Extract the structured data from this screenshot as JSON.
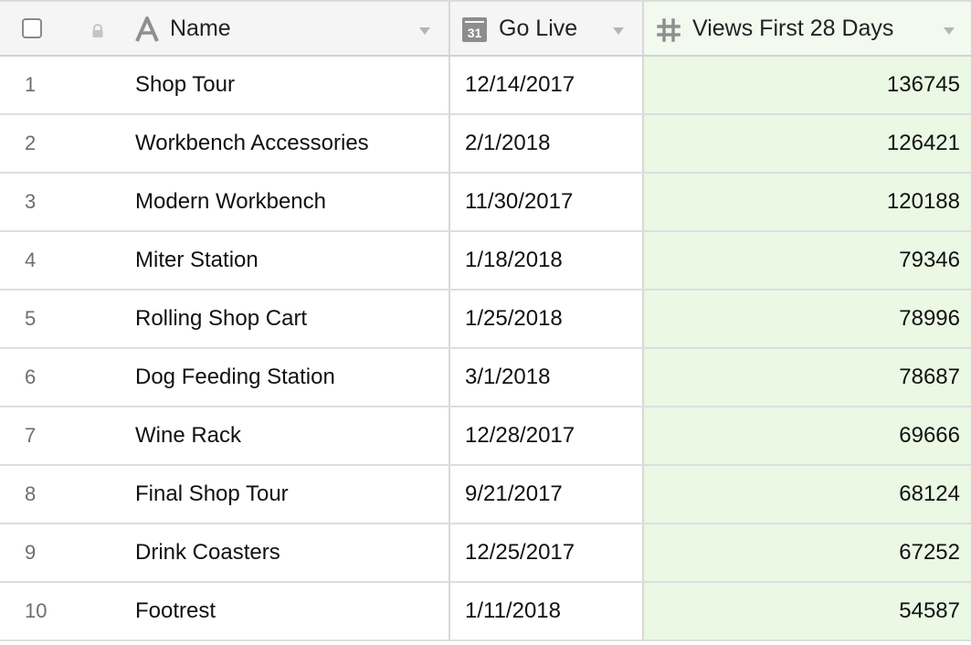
{
  "header": {
    "columns": [
      {
        "label": "Name",
        "type_icon": "text-type-icon"
      },
      {
        "label": "Go Live",
        "type_icon": "calendar-icon",
        "icon_text": "31"
      },
      {
        "label": "Views First 28 Days",
        "type_icon": "hash-icon"
      }
    ]
  },
  "colors": {
    "views_column_bg": "#eaf8e4",
    "header_bg": "#f5f5f5"
  },
  "rows": [
    {
      "num": "1",
      "name": "Shop Tour",
      "go_live": "12/14/2017",
      "views": "136745"
    },
    {
      "num": "2",
      "name": "Workbench Accessories",
      "go_live": "2/1/2018",
      "views": "126421"
    },
    {
      "num": "3",
      "name": "Modern Workbench",
      "go_live": "11/30/2017",
      "views": "120188"
    },
    {
      "num": "4",
      "name": "Miter Station",
      "go_live": "1/18/2018",
      "views": "79346"
    },
    {
      "num": "5",
      "name": "Rolling Shop Cart",
      "go_live": "1/25/2018",
      "views": "78996"
    },
    {
      "num": "6",
      "name": "Dog Feeding Station",
      "go_live": "3/1/2018",
      "views": "78687"
    },
    {
      "num": "7",
      "name": "Wine Rack",
      "go_live": "12/28/2017",
      "views": "69666"
    },
    {
      "num": "8",
      "name": "Final Shop Tour",
      "go_live": "9/21/2017",
      "views": "68124"
    },
    {
      "num": "9",
      "name": "Drink Coasters",
      "go_live": "12/25/2017",
      "views": "67252"
    },
    {
      "num": "10",
      "name": "Footrest",
      "go_live": "1/11/2018",
      "views": "54587"
    }
  ]
}
